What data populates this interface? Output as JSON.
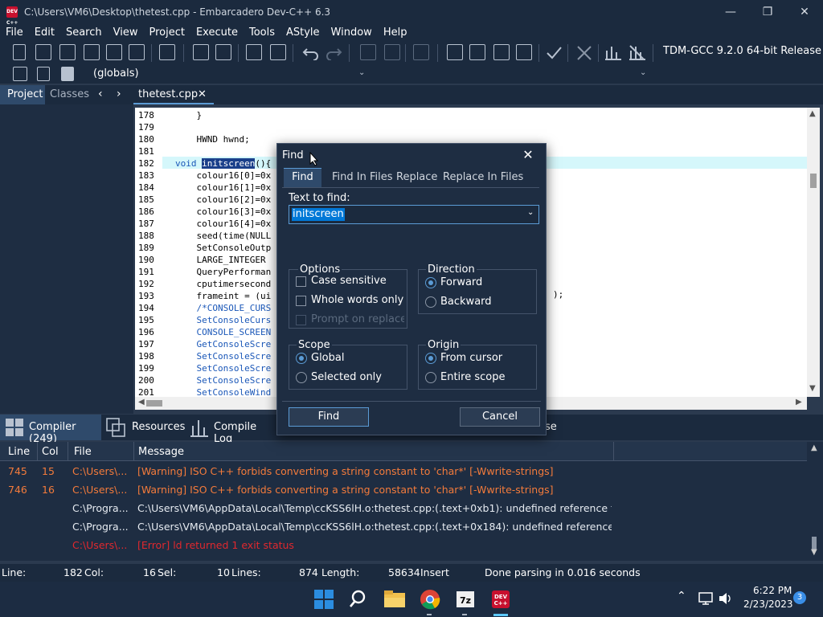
{
  "window": {
    "title": "C:\\Users\\VM6\\Desktop\\thetest.cpp - Embarcadero Dev-C++ 6.3",
    "app_icon_text": "DEV C++"
  },
  "menu": [
    "File",
    "Edit",
    "Search",
    "View",
    "Project",
    "Execute",
    "Tools",
    "AStyle",
    "Window",
    "Help"
  ],
  "toolbar": {
    "compiler": "TDM-GCC 9.2.0 64-bit Release",
    "scope": "(globals)"
  },
  "left_tabs": [
    "Project",
    "Classes"
  ],
  "editor_tab": "thetest.cpp",
  "editor": {
    "lines": [
      {
        "n": "178",
        "text": "    }"
      },
      {
        "n": "179",
        "text": ""
      },
      {
        "n": "180",
        "text": "    HWND hwnd;"
      },
      {
        "n": "181",
        "text": ""
      },
      {
        "n": "182",
        "text": "void initscreen(){"
      },
      {
        "n": "183",
        "text": "    colour16[0]=0x"
      },
      {
        "n": "184",
        "text": "    colour16[1]=0x"
      },
      {
        "n": "185",
        "text": "    colour16[2]=0x"
      },
      {
        "n": "186",
        "text": "    colour16[3]=0x"
      },
      {
        "n": "187",
        "text": "    colour16[4]=0x"
      },
      {
        "n": "188",
        "text": "    seed(time(NULL"
      },
      {
        "n": "189",
        "text": "    SetConsoleOutp"
      },
      {
        "n": "190",
        "text": "    LARGE_INTEGER"
      },
      {
        "n": "191",
        "text": "    QueryPerforman"
      },
      {
        "n": "192",
        "text": "    cputimersecond"
      },
      {
        "n": "193",
        "text": "    frameint = (ui"
      },
      {
        "n": "194",
        "text": "    /*CONSOLE_CURS"
      },
      {
        "n": "195",
        "text": "    SetConsoleCurs"
      },
      {
        "n": "196",
        "text": "    CONSOLE_SCREEN"
      },
      {
        "n": "197",
        "text": "    GetConsoleScre"
      },
      {
        "n": "198",
        "text": "    SetConsoleScre"
      },
      {
        "n": "199",
        "text": "    SetConsoleScre"
      },
      {
        "n": "200",
        "text": "    SetConsoleScre"
      },
      {
        "n": "201",
        "text": "    SetConsoleWind"
      }
    ],
    "line193_tail": ");"
  },
  "bottom_tabs": [
    "Compiler (249)",
    "Resources",
    "Compile Log",
    "se"
  ],
  "messages": {
    "headers": [
      "Line",
      "Col",
      "File",
      "Message"
    ],
    "rows": [
      {
        "line": "745",
        "col": "15",
        "file": "C:\\Users\\...",
        "msg": "[Warning] ISO C++ forbids converting a string constant to 'char*' [-Wwrite-strings]",
        "kind": "warning"
      },
      {
        "line": "746",
        "col": "16",
        "file": "C:\\Users\\...",
        "msg": "[Warning] ISO C++ forbids converting a string constant to 'char*' [-Wwrite-strings]",
        "kind": "warning"
      },
      {
        "line": "",
        "col": "",
        "file": "C:\\Progra...",
        "msg": "C:\\Users\\VM6\\AppData\\Local\\Temp\\ccKSS6lH.o:thetest.cpp:(.text+0xb1): undefined reference to `__i...",
        "kind": "info"
      },
      {
        "line": "",
        "col": "",
        "file": "C:\\Progra...",
        "msg": "C:\\Users\\VM6\\AppData\\Local\\Temp\\ccKSS6lH.o:thetest.cpp:(.text+0x184): undefined reference to `__...",
        "kind": "info"
      },
      {
        "line": "",
        "col": "",
        "file": "C:\\Users\\...",
        "msg": "[Error] ld returned 1 exit status",
        "kind": "error"
      }
    ]
  },
  "status": {
    "line_label": "Line:",
    "line_val": "182",
    "col_label": "Col:",
    "col_val": "16",
    "sel_label": "Sel:",
    "sel_val": "10",
    "lines_label": "Lines:",
    "lines_val": "874",
    "length_label": "Length:",
    "length_val": "58634",
    "mode": "Insert",
    "message": "Done parsing in 0.016 seconds"
  },
  "find_dialog": {
    "title": "Find",
    "tabs": [
      "Find",
      "Find In Files",
      "Replace",
      "Replace In Files"
    ],
    "text_to_find_label": "Text to find:",
    "text_to_find_value": "initscreen",
    "options_title": "Options",
    "options": [
      {
        "label": "Case sensitive",
        "checked": false,
        "enabled": true
      },
      {
        "label": "Whole words only",
        "checked": false,
        "enabled": true
      },
      {
        "label": "Prompt on replace",
        "checked": false,
        "enabled": false
      }
    ],
    "direction_title": "Direction",
    "direction": [
      "Forward",
      "Backward"
    ],
    "scope_title": "Scope",
    "scope": [
      "Global",
      "Selected only"
    ],
    "origin_title": "Origin",
    "origin": [
      "From cursor",
      "Entire scope"
    ],
    "find_button": "Find",
    "cancel_button": "Cancel"
  },
  "taskbar": {
    "time": "6:22 PM",
    "date": "2/23/2023",
    "notifications": "3",
    "apps": [
      "start-icon",
      "search-icon",
      "file-explorer-icon",
      "chrome-icon",
      "7zip-icon",
      "devcpp-icon"
    ]
  }
}
